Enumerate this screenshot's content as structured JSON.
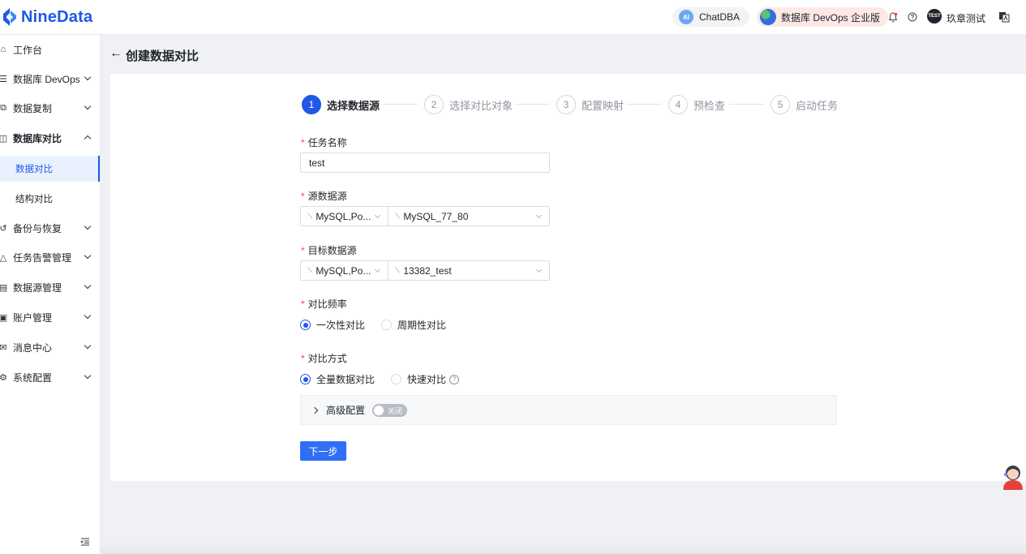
{
  "app": {
    "brand": "NineData"
  },
  "header": {
    "chatdba_badge": "AI",
    "chatdba_label": "ChatDBA",
    "edition_label": "数据库 DevOps 企业版",
    "avatar_text": "TEST",
    "user_name": "玖章测试"
  },
  "sidebar": {
    "items": [
      {
        "label": "工作台"
      },
      {
        "label": "数据库 DevOps"
      },
      {
        "label": "数据复制"
      },
      {
        "label": "数据库对比"
      },
      {
        "label": "备份与恢复"
      },
      {
        "label": "任务告警管理"
      },
      {
        "label": "数据源管理"
      },
      {
        "label": "账户管理"
      },
      {
        "label": "消息中心"
      },
      {
        "label": "系统配置"
      }
    ],
    "sub_items": [
      {
        "label": "数据对比"
      },
      {
        "label": "结构对比"
      }
    ]
  },
  "page": {
    "title": "创建数据对比"
  },
  "steps": [
    {
      "num": "1",
      "label": "选择数据源"
    },
    {
      "num": "2",
      "label": "选择对比对象"
    },
    {
      "num": "3",
      "label": "配置映射"
    },
    {
      "num": "4",
      "label": "预检查"
    },
    {
      "num": "5",
      "label": "启动任务"
    }
  ],
  "form": {
    "required_mark": "*",
    "task_name_label": "任务名称",
    "task_name_value": "test",
    "source_label": "源数据源",
    "source_type": "MySQL,Po...",
    "source_value": "MySQL_77_80",
    "target_label": "目标数据源",
    "target_type": "MySQL,Po...",
    "target_value": "13382_test",
    "frequency_label": "对比频率",
    "frequency_options": [
      "一次性对比",
      "周期性对比"
    ],
    "method_label": "对比方式",
    "method_options": [
      "全量数据对比",
      "快速对比"
    ],
    "advanced_label": "高级配置",
    "advanced_toggle": "关闭",
    "next_button": "下一步"
  }
}
